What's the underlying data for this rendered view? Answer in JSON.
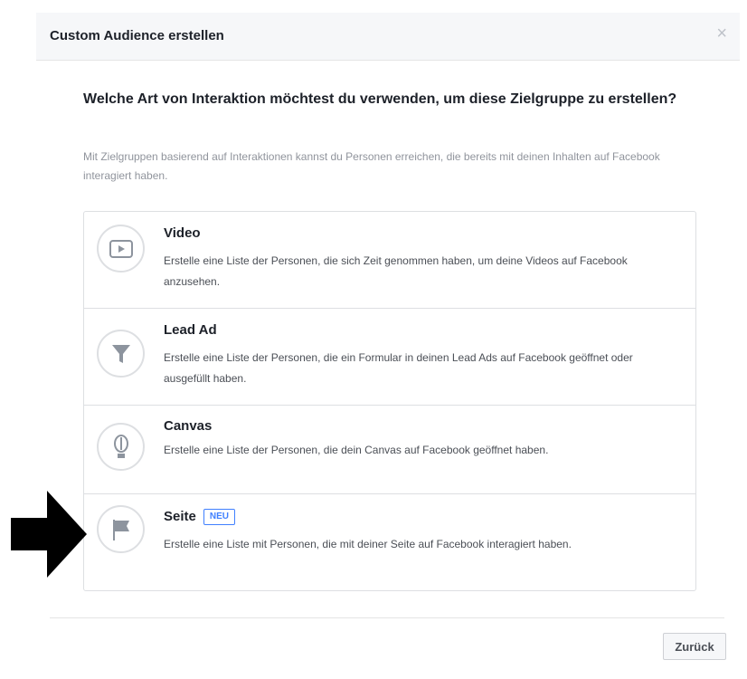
{
  "dialog": {
    "title": "Custom Audience erstellen",
    "close_icon": "close-icon",
    "question": "Welche Art von Interaktion möchtest du verwenden, um diese Zielgruppe zu erstellen?",
    "subtext": "Mit Zielgruppen basierend auf Interaktionen kannst du Personen erreichen, die bereits mit deinen Inhalten auf Facebook interagiert haben."
  },
  "options": [
    {
      "title": "Video",
      "description": "Erstelle eine Liste der Personen, die sich Zeit genommen haben, um deine Videos auf Facebook anzusehen.",
      "icon": "video-play-icon"
    },
    {
      "title": "Lead Ad",
      "description": "Erstelle eine Liste der Personen, die ein Formular in deinen Lead Ads auf Facebook geöffnet oder ausgefüllt haben.",
      "icon": "funnel-icon"
    },
    {
      "title": "Canvas",
      "description": "Erstelle eine Liste der Personen, die dein Canvas auf Facebook geöffnet haben.",
      "icon": "canvas-icon"
    },
    {
      "title": "Seite",
      "badge": "NEU",
      "description": "Erstelle eine Liste mit Personen, die mit deiner Seite auf Facebook interagiert haben.",
      "icon": "flag-icon"
    }
  ],
  "footer": {
    "back_label": "Zurück"
  },
  "annotation": {
    "icon": "arrow-right-icon",
    "color": "#000000"
  },
  "colors": {
    "header_bg": "#f6f7f9",
    "badge": "#4080ff",
    "icon_gray": "#8d949e",
    "border": "#dddfe2"
  }
}
